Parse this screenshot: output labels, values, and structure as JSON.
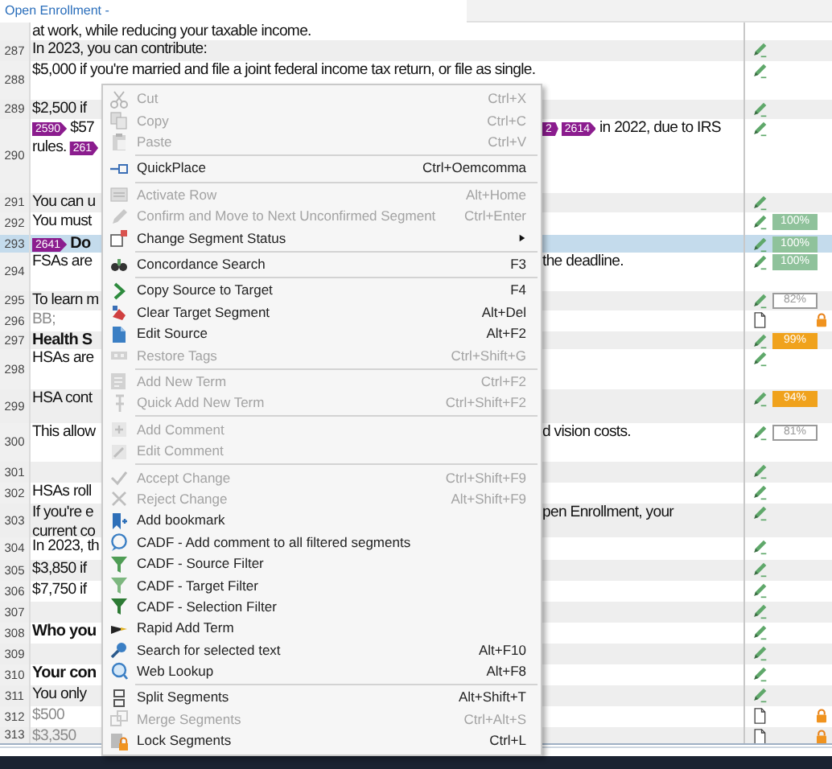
{
  "document_tab": {
    "title": "Open Enrollment -"
  },
  "rows": [
    {
      "kind": "text",
      "selected": false,
      "locked": false,
      "lines": [
        [
          {
            "text": "at work, while reducing your taxable income."
          }
        ]
      ]
    },
    {
      "number": "287",
      "kind": "text",
      "selected": false,
      "status": {
        "kind": "translated"
      },
      "locked": false,
      "lines": [
        [
          {
            "text": "In 2023, you can contribute:"
          }
        ]
      ]
    },
    {
      "number": "288",
      "kind": "text",
      "selected": false,
      "status": {
        "kind": "translated"
      },
      "locked": false,
      "lines": [
        [
          {
            "text": "$5,000 if you're married and file a joint federal income tax return, or file as single."
          }
        ]
      ]
    },
    {
      "number": "289",
      "kind": "text",
      "selected": false,
      "status": {
        "kind": "translated"
      },
      "locked": false,
      "lines": [
        [
          {
            "text": "$2,500 if"
          }
        ]
      ]
    },
    {
      "number": "290",
      "kind": "text",
      "selected": false,
      "status": {
        "kind": "translated"
      },
      "locked": false,
      "lines": [
        [
          {
            "tag": "2590"
          },
          {
            "text": "$57"
          }
        ],
        [
          {
            "text": "rules."
          },
          {
            "tag": "261"
          }
        ]
      ],
      "tail": [
        [
          {
            "tag": "2"
          },
          {
            "tag": "2614"
          },
          {
            "text": "in 2022, due to IRS"
          }
        ]
      ]
    },
    {
      "number": "291",
      "kind": "text",
      "selected": false,
      "status": {
        "kind": "translated"
      },
      "locked": false,
      "lines": [
        [
          {
            "text": "You can u"
          }
        ]
      ]
    },
    {
      "number": "292",
      "kind": "text",
      "selected": false,
      "status": {
        "kind": "translated"
      },
      "locked": false,
      "match": {
        "text": "100%",
        "kind": "exact"
      },
      "lines": [
        [
          {
            "text": "You must"
          }
        ]
      ]
    },
    {
      "number": "293",
      "kind": "heading",
      "selected": true,
      "status": {
        "kind": "translated"
      },
      "locked": false,
      "match": {
        "text": "100%",
        "kind": "exact"
      },
      "lines": [
        [
          {
            "tag": "2641"
          },
          {
            "text": "Do"
          }
        ]
      ]
    },
    {
      "number": "294",
      "kind": "text",
      "selected": false,
      "status": {
        "kind": "translated"
      },
      "locked": false,
      "match": {
        "text": "100%",
        "kind": "exact"
      },
      "lines": [
        [
          {
            "text": "FSAs are"
          }
        ]
      ],
      "tail": [
        [
          {
            "text": "the deadline."
          }
        ]
      ]
    },
    {
      "number": "295",
      "kind": "text",
      "selected": false,
      "status": {
        "kind": "translated"
      },
      "locked": false,
      "match": {
        "text": "82%",
        "kind": "low"
      },
      "lines": [
        [
          {
            "text": "To learn m"
          }
        ]
      ]
    },
    {
      "number": "296",
      "kind": "muted",
      "selected": false,
      "status": {
        "kind": "untranslated"
      },
      "locked": true,
      "lines": [
        [
          {
            "text": "BB;"
          }
        ]
      ]
    },
    {
      "number": "297",
      "kind": "heading",
      "selected": false,
      "status": {
        "kind": "translated"
      },
      "locked": false,
      "match": {
        "text": "99%",
        "kind": "fuzzy"
      },
      "lines": [
        [
          {
            "text": "Health S"
          }
        ]
      ]
    },
    {
      "number": "298",
      "kind": "text",
      "selected": false,
      "status": {
        "kind": "translated"
      },
      "locked": false,
      "lines": [
        [
          {
            "text": "HSAs are"
          }
        ]
      ]
    },
    {
      "number": "299",
      "kind": "text",
      "selected": false,
      "status": {
        "kind": "translated"
      },
      "locked": false,
      "match": {
        "text": "94%",
        "kind": "fuzzy"
      },
      "lines": [
        [
          {
            "text": "HSA cont"
          }
        ]
      ]
    },
    {
      "number": "300",
      "kind": "text",
      "selected": false,
      "status": {
        "kind": "translated"
      },
      "locked": false,
      "match": {
        "text": "81%",
        "kind": "low"
      },
      "lines": [
        [
          {
            "text": "This allow"
          }
        ]
      ],
      "tail": [
        [
          {
            "text": "d vision costs."
          }
        ]
      ]
    },
    {
      "number": "301",
      "kind": "text",
      "selected": false,
      "status": {
        "kind": "translated"
      },
      "locked": false,
      "lines": []
    },
    {
      "number": "302",
      "kind": "text",
      "selected": false,
      "status": {
        "kind": "translated"
      },
      "locked": false,
      "lines": [
        [
          {
            "text": "HSAs roll"
          }
        ]
      ]
    },
    {
      "number": "303",
      "kind": "text",
      "selected": false,
      "status": {
        "kind": "translated"
      },
      "locked": false,
      "lines": [
        [
          {
            "text": "If you're e"
          }
        ],
        [
          {
            "text": "current co"
          }
        ]
      ],
      "tail": [
        [
          {
            "text": "pen Enrollment, your"
          }
        ]
      ]
    },
    {
      "number": "304",
      "kind": "text",
      "selected": false,
      "status": {
        "kind": "translated"
      },
      "locked": false,
      "lines": [
        [
          {
            "text": "In 2023, th"
          }
        ]
      ]
    },
    {
      "number": "305",
      "kind": "text",
      "selected": false,
      "status": {
        "kind": "translated"
      },
      "locked": false,
      "lines": [
        [
          {
            "text": "$3,850 if"
          }
        ]
      ]
    },
    {
      "number": "306",
      "kind": "text",
      "selected": false,
      "status": {
        "kind": "translated"
      },
      "locked": false,
      "lines": [
        [
          {
            "text": "$7,750 if"
          }
        ]
      ]
    },
    {
      "number": "307",
      "kind": "text",
      "selected": false,
      "status": {
        "kind": "translated"
      },
      "locked": false,
      "lines": []
    },
    {
      "number": "308",
      "kind": "heading",
      "selected": false,
      "status": {
        "kind": "translated"
      },
      "locked": false,
      "lines": [
        [
          {
            "text": "Who you"
          }
        ]
      ]
    },
    {
      "number": "309",
      "kind": "text",
      "selected": false,
      "status": {
        "kind": "translated"
      },
      "locked": false,
      "lines": []
    },
    {
      "number": "310",
      "kind": "heading",
      "selected": false,
      "status": {
        "kind": "translated"
      },
      "locked": false,
      "lines": [
        [
          {
            "text": "Your con"
          }
        ]
      ]
    },
    {
      "number": "311",
      "kind": "text",
      "selected": false,
      "status": {
        "kind": "translated"
      },
      "locked": false,
      "lines": [
        [
          {
            "text": "You only"
          }
        ]
      ]
    },
    {
      "number": "312",
      "kind": "muted",
      "selected": false,
      "status": {
        "kind": "untranslated"
      },
      "locked": true,
      "lines": [
        [
          {
            "text": "$500"
          }
        ]
      ]
    },
    {
      "number": "313",
      "kind": "muted",
      "selected": false,
      "status": {
        "kind": "untranslated"
      },
      "locked": true,
      "lines": [
        [
          {
            "text": "$3,350"
          }
        ]
      ]
    }
  ],
  "context_menu": [
    {
      "kind": "item",
      "label": "Cut",
      "shortcut": "Ctrl+X",
      "disabled": true
    },
    {
      "kind": "item",
      "label": "Copy",
      "shortcut": "Ctrl+C",
      "disabled": true
    },
    {
      "kind": "item",
      "label": "Paste",
      "shortcut": "Ctrl+V",
      "disabled": true
    },
    {
      "kind": "separator"
    },
    {
      "kind": "item",
      "label": "QuickPlace",
      "shortcut": "Ctrl+Oemcomma",
      "disabled": false
    },
    {
      "kind": "separator"
    },
    {
      "kind": "item",
      "label": "Activate Row",
      "shortcut": "Alt+Home",
      "disabled": true
    },
    {
      "kind": "item",
      "label": "Confirm and Move to Next Unconfirmed Segment",
      "shortcut": "Ctrl+Enter",
      "disabled": true
    },
    {
      "kind": "submenu",
      "label": "Change Segment Status",
      "disabled": false
    },
    {
      "kind": "separator"
    },
    {
      "kind": "item",
      "label": "Concordance Search",
      "shortcut": "F3",
      "disabled": false
    },
    {
      "kind": "separator"
    },
    {
      "kind": "item",
      "label": "Copy Source to Target",
      "shortcut": "F4",
      "disabled": false
    },
    {
      "kind": "item",
      "label": "Clear Target Segment",
      "shortcut": "Alt+Del",
      "disabled": false
    },
    {
      "kind": "item",
      "label": "Edit Source",
      "shortcut": "Alt+F2",
      "disabled": false
    },
    {
      "kind": "item",
      "label": "Restore Tags",
      "shortcut": "Ctrl+Shift+G",
      "disabled": true
    },
    {
      "kind": "separator"
    },
    {
      "kind": "item",
      "label": "Add New Term",
      "shortcut": "Ctrl+F2",
      "disabled": true
    },
    {
      "kind": "item",
      "label": "Quick Add New Term",
      "shortcut": "Ctrl+Shift+F2",
      "disabled": true
    },
    {
      "kind": "separator"
    },
    {
      "kind": "item",
      "label": "Add Comment",
      "disabled": true
    },
    {
      "kind": "item",
      "label": "Edit Comment",
      "disabled": true
    },
    {
      "kind": "separator"
    },
    {
      "kind": "item",
      "label": "Accept Change",
      "shortcut": "Ctrl+Shift+F9",
      "disabled": true
    },
    {
      "kind": "item",
      "label": "Reject Change",
      "shortcut": "Alt+Shift+F9",
      "disabled": true
    },
    {
      "kind": "item",
      "label": "Add bookmark",
      "disabled": false
    },
    {
      "kind": "item",
      "label": "CADF - Add comment to all filtered segments",
      "disabled": false
    },
    {
      "kind": "item",
      "label": "CADF - Source Filter",
      "disabled": false
    },
    {
      "kind": "item",
      "label": "CADF - Target Filter",
      "disabled": false
    },
    {
      "kind": "item",
      "label": "CADF - Selection Filter",
      "disabled": false
    },
    {
      "kind": "item",
      "label": "Rapid Add Term",
      "disabled": false
    },
    {
      "kind": "item",
      "label": "Search for selected text",
      "shortcut": "Alt+F10",
      "disabled": false
    },
    {
      "kind": "item",
      "label": "Web Lookup",
      "shortcut": "Alt+F8",
      "disabled": false
    },
    {
      "kind": "separator"
    },
    {
      "kind": "item",
      "label": "Split Segments",
      "shortcut": "Alt+Shift+T",
      "disabled": false
    },
    {
      "kind": "item",
      "label": "Merge Segments",
      "shortcut": "Ctrl+Alt+S",
      "disabled": true
    },
    {
      "kind": "item",
      "label": "Lock Segments",
      "shortcut": "Ctrl+L",
      "disabled": false
    }
  ]
}
